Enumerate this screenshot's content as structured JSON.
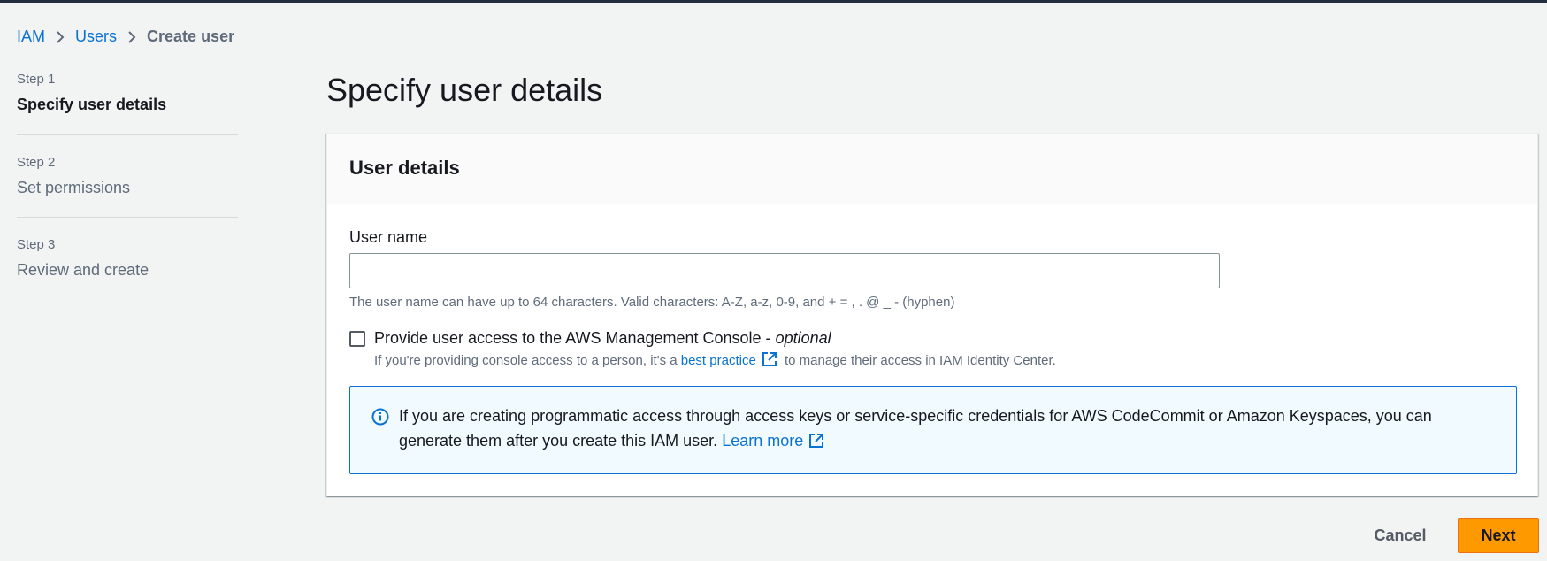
{
  "breadcrumb": {
    "items": [
      {
        "label": "IAM"
      },
      {
        "label": "Users"
      },
      {
        "label": "Create user"
      }
    ]
  },
  "steps": [
    {
      "step_label": "Step 1",
      "title": "Specify user details",
      "active": true
    },
    {
      "step_label": "Step 2",
      "title": "Set permissions",
      "active": false
    },
    {
      "step_label": "Step 3",
      "title": "Review and create",
      "active": false
    }
  ],
  "page": {
    "title": "Specify user details"
  },
  "user_details": {
    "header": "User details",
    "user_name_label": "User name",
    "user_name_value": "",
    "user_name_hint": "The user name can have up to 64 characters. Valid characters: A-Z, a-z, 0-9, and + = , . @ _ - (hyphen)",
    "console_access": {
      "checked": false,
      "label": "Provide user access to the AWS Management Console - ",
      "label_optional": "optional",
      "desc_before": "If you're providing console access to a person, it's a ",
      "desc_link": "best practice",
      "desc_after": " to manage their access in IAM Identity Center."
    },
    "alert": {
      "text": "If you are creating programmatic access through access keys or service-specific credentials for AWS CodeCommit or Amazon Keyspaces, you can generate them after you create this IAM user. ",
      "link": "Learn more"
    }
  },
  "actions": {
    "cancel_label": "Cancel",
    "next_label": "Next"
  },
  "colors": {
    "link": "#0972d3",
    "primary_button": "#ff9900",
    "background": "#f2f3f3",
    "alert_background": "#f1faff"
  }
}
